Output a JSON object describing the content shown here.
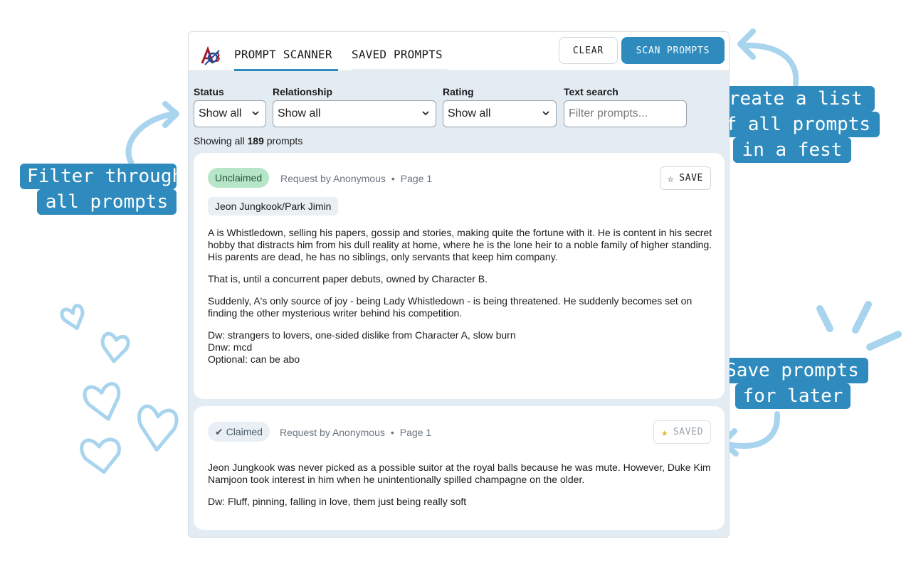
{
  "callouts": {
    "filter": [
      "Filter through",
      "all prompts"
    ],
    "create": [
      "Create a list",
      "of all prompts",
      "in a fest"
    ],
    "save": [
      "Save prompts",
      "for later"
    ]
  },
  "header": {
    "logo": "AO3",
    "tabs": [
      {
        "label": "PROMPT SCANNER",
        "active": true
      },
      {
        "label": "SAVED PROMPTS",
        "active": false
      }
    ],
    "clear_label": "CLEAR",
    "scan_label": "SCAN PROMPTS"
  },
  "filters": {
    "status": {
      "label": "Status",
      "value": "Show all"
    },
    "relationship": {
      "label": "Relationship",
      "value": "Show all"
    },
    "rating": {
      "label": "Rating",
      "value": "Show all"
    },
    "text_search": {
      "label": "Text search",
      "placeholder": "Filter prompts..."
    }
  },
  "summary": {
    "prefix": "Showing all",
    "count": "189",
    "suffix": "prompts"
  },
  "prompts": [
    {
      "status": "Unclaimed",
      "requester": "Request by Anonymous",
      "page": "Page 1",
      "save_label": "SAVE",
      "save_icon": "star-outline-icon",
      "relationship": "Jeon Jungkook/Park Jimin",
      "paragraphs": [
        "A is Whistledown, selling his papers, gossip and stories, making quite the fortune with it. He is content in his secret hobby that distracts him from his dull reality at home, where he is the lone heir to a noble family of higher standing. His parents are dead, he has no siblings, only servants that keep him company.",
        "That is, until a concurrent paper debuts, owned by Character B.",
        "Suddenly, A's only source of joy - being Lady Whistledown - is being threatened. He suddenly becomes set on finding the other mysterious writer behind his competition.",
        "Dw: strangers to lovers, one-sided dislike from Character A, slow burn\nDnw: mcd\nOptional: can be abo"
      ]
    },
    {
      "status": "✔ Claimed",
      "requester": "Request by Anonymous",
      "page": "Page 1",
      "save_label": "SAVED",
      "save_icon": "star-filled-icon",
      "paragraphs": [
        "Jeon Jungkook was never picked as a possible suitor at the royal balls because he was mute. However, Duke Kim Namjoon took interest in him when he unintentionally spilled champagne on the older.",
        "Dw: Fluff, pinning, falling in love, them just being really soft"
      ]
    }
  ],
  "colors": {
    "accent": "#2f8bbd",
    "panel_bg": "#e4ecf3",
    "unclaimed_badge": "#b6e5c8",
    "deco": "#a9d4ee",
    "saved_star": "#e0b52a"
  }
}
